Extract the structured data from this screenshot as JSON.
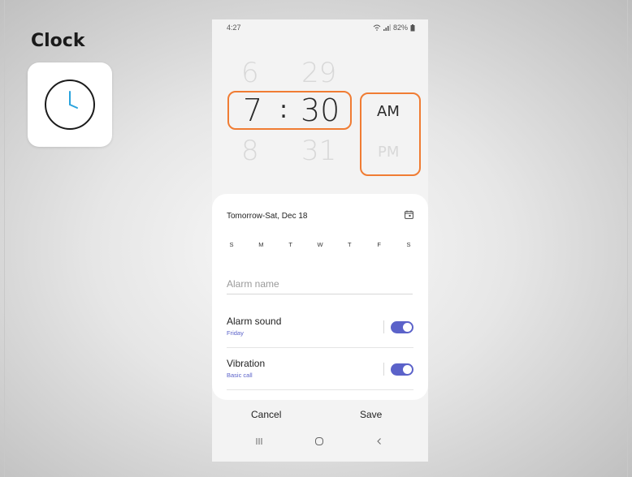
{
  "page": {
    "label": "Clock",
    "app_icon": "clock-icon"
  },
  "status_bar": {
    "time": "4:27",
    "battery": "82%",
    "icons": [
      "wifi-icon",
      "signal-icon",
      "battery-icon"
    ]
  },
  "time_picker": {
    "hour_prev": "6",
    "hour": "7",
    "hour_next": "8",
    "separator": ":",
    "minute_prev": "29",
    "minute": "30",
    "minute_next": "31",
    "am_label": "AM",
    "pm_label": "PM",
    "selected_period": "AM"
  },
  "highlight_color": "#f07c33",
  "sheet": {
    "date_text": "Tomorrow-Sat, Dec 18",
    "calendar_icon": "calendar-icon",
    "days": [
      "S",
      "M",
      "T",
      "W",
      "T",
      "F",
      "S"
    ],
    "alarm_name_placeholder": "Alarm name",
    "settings": [
      {
        "title": "Alarm sound",
        "subtitle": "Friday",
        "enabled": true
      },
      {
        "title": "Vibration",
        "subtitle": "Basic call",
        "enabled": true
      }
    ]
  },
  "accent_color": "#5b62c9",
  "actions": {
    "cancel": "Cancel",
    "save": "Save"
  },
  "nav": {
    "recents_icon": "recents-icon",
    "home_icon": "home-icon",
    "back_icon": "back-icon"
  }
}
